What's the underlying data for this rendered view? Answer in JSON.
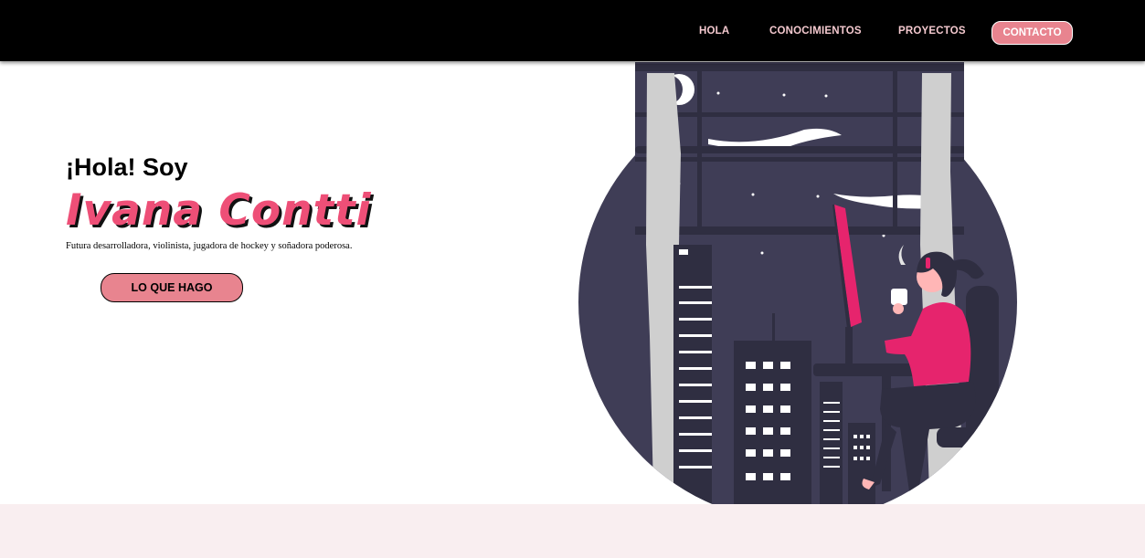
{
  "nav": {
    "items": [
      {
        "label": "HOLA"
      },
      {
        "label": "CONOCIMIENTOS"
      },
      {
        "label": "PROYECTOS"
      }
    ],
    "contact_label": "CONTACTO"
  },
  "hero": {
    "greeting": "¡Hola! Soy",
    "name": "Ivana Contti",
    "subtitle": "Futura desarrolladora, violinista, jugadora de hockey y soñadora poderosa.",
    "cta_label": "LO QUE HAGO",
    "illustration": "woman-at-desk-city-window-illustration"
  },
  "colors": {
    "nav_background": "#000000",
    "nav_text": "#f4c9cf",
    "accent_pink": "#ee4f77",
    "button_pink": "#e8848f",
    "illustration_dark": "#3f3d56",
    "bottom_band": "#f9eef0"
  }
}
